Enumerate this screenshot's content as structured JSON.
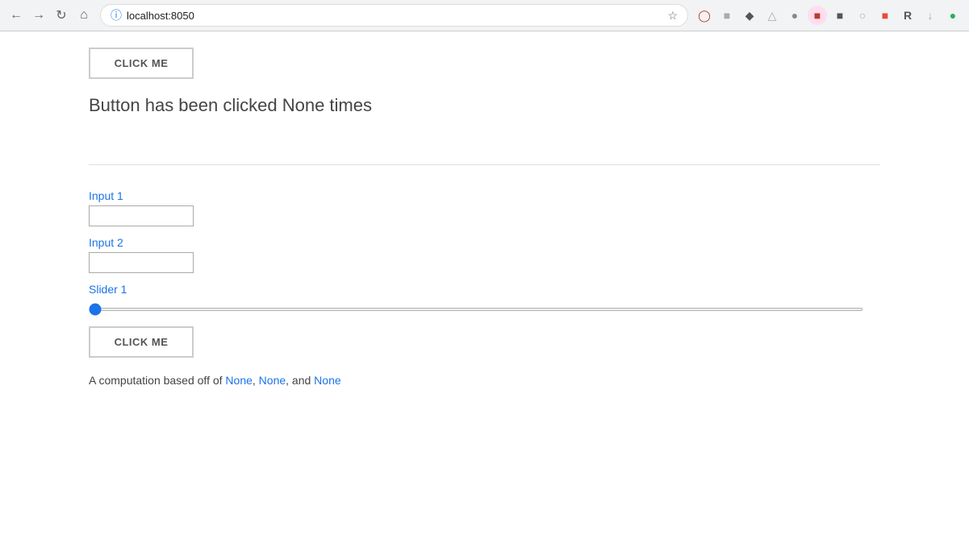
{
  "browser": {
    "url": "localhost:8050",
    "back_btn": "←",
    "forward_btn": "→",
    "reload_btn": "↻",
    "home_btn": "⌂",
    "star_icon": "☆"
  },
  "section1": {
    "button_label": "CLICK ME",
    "click_count_text": "Button has been clicked None times"
  },
  "section2": {
    "input1_label": "Input 1",
    "input1_value": "",
    "input1_placeholder": "",
    "input2_label": "Input 2",
    "input2_value": "",
    "input2_placeholder": "",
    "slider_label": "Slider 1",
    "slider_value": 0,
    "slider_min": 0,
    "slider_max": 100,
    "button_label": "CLICK ME",
    "computation_prefix": "A computation based off of ",
    "computation_val1": "None",
    "computation_sep1": ", ",
    "computation_val2": "None",
    "computation_sep2": ", and ",
    "computation_val3": "None"
  }
}
